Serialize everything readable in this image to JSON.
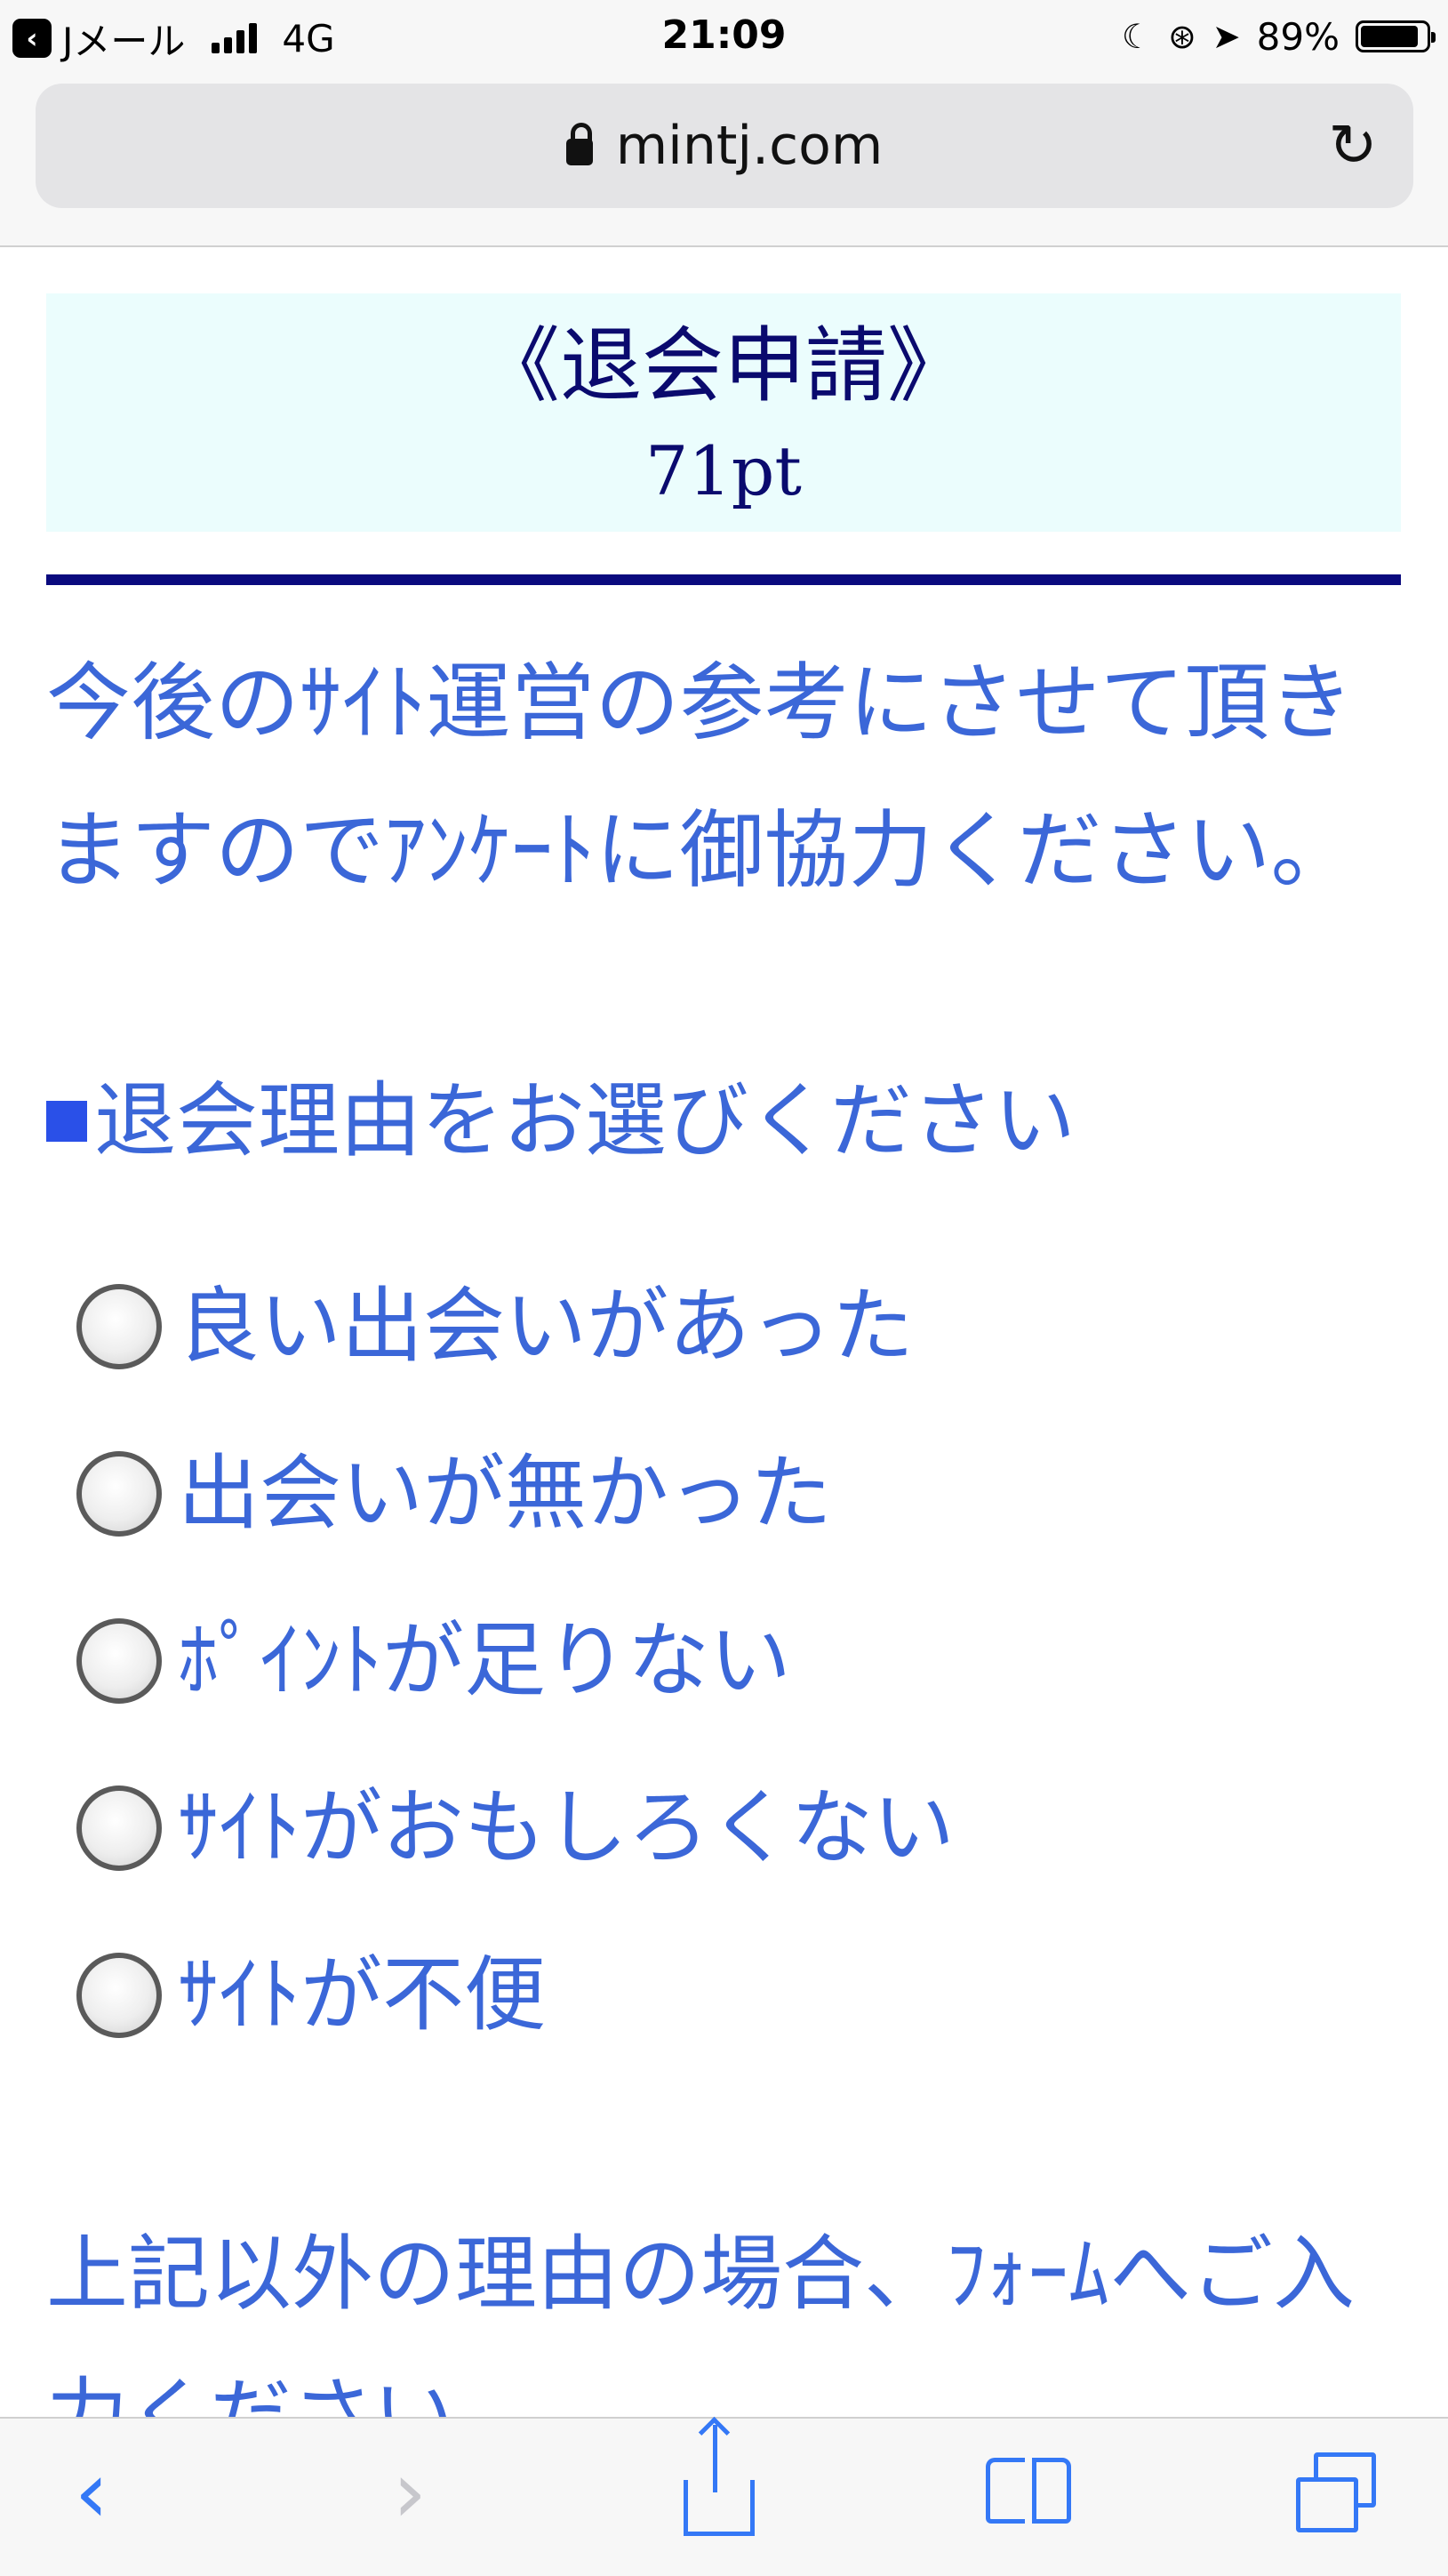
{
  "status_bar": {
    "carrier_back": "Jメール",
    "network": "4G",
    "time": "21:09",
    "battery": "89%",
    "battery_level": 0.89,
    "icons": [
      "back-to-app-icon",
      "signal-icon",
      "moon-icon",
      "orientation-lock-icon",
      "location-icon",
      "battery-icon"
    ]
  },
  "address_bar": {
    "url": "mintj.com",
    "icons": [
      "lock-icon",
      "reload-icon"
    ]
  },
  "page": {
    "title": "《退会申請》",
    "points": "71pt",
    "intro": "今後のｻｲﾄ運営の参考にさせて頂きますのでｱﾝｹｰﾄに御協力ください。",
    "question": "退会理由をお選びください",
    "reasons": [
      "良い出会いがあった",
      "出会いが無かった",
      "ﾎﾟｲﾝﾄが足りない",
      "ｻｲﾄがおもしろくない",
      "ｻｲﾄが不便"
    ],
    "other_note": "上記以外の理由の場合、ﾌｫｰﾑへご入力ください。"
  },
  "toolbar": {
    "icons": [
      "back-icon",
      "forward-icon",
      "share-icon",
      "bookmarks-icon",
      "tabs-icon"
    ],
    "accent": "#3478f6",
    "disabled": "#c7c7cc"
  },
  "colors": {
    "title_text": "#0a0a6e",
    "header_bg": "#ebfdfd",
    "body_text": "#3b67d8",
    "rule": "#0a0a7e"
  }
}
